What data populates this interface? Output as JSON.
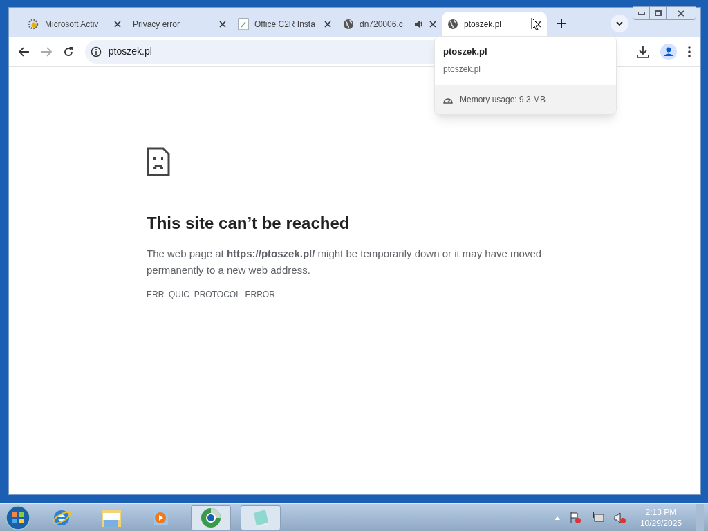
{
  "tabs": [
    {
      "title": "Microsoft Activ",
      "kind": "gear",
      "selected": false,
      "audio": false
    },
    {
      "title": "Privacy error",
      "kind": "none",
      "selected": false,
      "audio": false
    },
    {
      "title": "Office C2R Insta",
      "kind": "document",
      "selected": false,
      "audio": false
    },
    {
      "title": "dn720006.c",
      "kind": "globe",
      "selected": false,
      "audio": true
    },
    {
      "title": "ptoszek.pl",
      "kind": "globe",
      "selected": true,
      "audio": false
    }
  ],
  "address": "ptoszek.pl",
  "hover_card": {
    "title": "ptoszek.pl",
    "domain": "ptoszek.pl",
    "memory": "Memory usage: 9.3 MB"
  },
  "error_page": {
    "heading": "This site can’t be reached",
    "message": "The web page at **https://ptoszek.pl/** might be temporarily down or it may have moved permanently to a new web address.",
    "code": "ERR_QUIC_PROTOCOL_ERROR"
  },
  "taskbar": {
    "pinned": [
      {
        "kind": "ie",
        "active": false
      },
      {
        "kind": "explorer",
        "active": false
      },
      {
        "kind": "media",
        "active": false
      },
      {
        "kind": "chrome",
        "active": true
      },
      {
        "kind": "notepad",
        "active": true
      }
    ]
  },
  "clock": {
    "time": "2:13 PM",
    "date": "10/29/2025"
  }
}
